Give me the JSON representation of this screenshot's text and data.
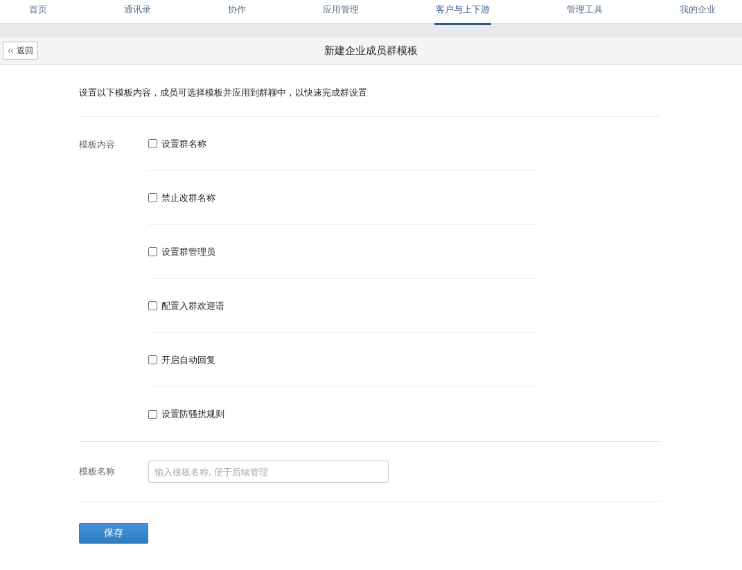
{
  "nav": [
    {
      "label": "首页",
      "selected": false
    },
    {
      "label": "通讯录",
      "selected": false
    },
    {
      "label": "协作",
      "selected": false
    },
    {
      "label": "应用管理",
      "selected": false
    },
    {
      "label": "客户与上下游",
      "selected": true
    },
    {
      "label": "管理工具",
      "selected": false
    },
    {
      "label": "我的企业",
      "selected": false
    }
  ],
  "header": {
    "back": "返回",
    "title": "新建企业成员群模板"
  },
  "intro": "设置以下模板内容，成员可选择模板并应用到群聊中，以快速完成群设置",
  "content": {
    "label": "模板内容",
    "options": [
      {
        "label": "设置群名称",
        "checked": false
      },
      {
        "label": "禁止改群名称",
        "checked": false
      },
      {
        "label": "设置群管理员",
        "checked": false
      },
      {
        "label": "配置入群欢迎语",
        "checked": false
      },
      {
        "label": "开启自动回复",
        "checked": false
      },
      {
        "label": "设置防骚扰规则",
        "checked": false
      }
    ]
  },
  "name_field": {
    "label": "模板名称",
    "placeholder": "输入模板名称, 便于后续管理"
  },
  "save": "保存"
}
